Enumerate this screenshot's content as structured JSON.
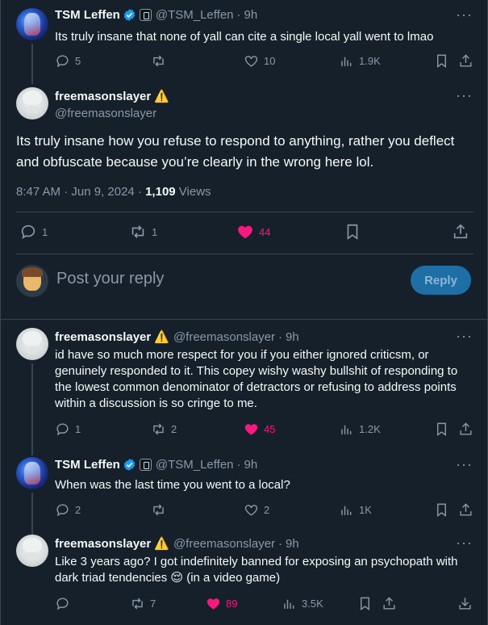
{
  "colors": {
    "background": "#15202b",
    "text": "#f7f9f9",
    "muted": "#8b98a5",
    "like": "#f91880",
    "accent": "#1d9bf0",
    "border": "#38444d"
  },
  "tweets": [
    {
      "name": "TSM Leffen",
      "handle": "@TSM_Leffen",
      "time": "9h",
      "text": "Its truly insane that none of yall can cite a single local yall went to lmao",
      "replies": "5",
      "retweets": "",
      "likes": "10",
      "views": "1.9K",
      "verified": true,
      "liked": false
    },
    {
      "name": "freemasonslayer",
      "handle": "@freemasonslayer",
      "text": "Its truly insane how you refuse to respond to anything, rather you deflect and obfuscate because you’re clearly in the wrong here lol.",
      "timestamp": "8:47 AM · Jun 9, 2024 · ",
      "views_count": "1,109",
      "views_label": " Views",
      "replies": "1",
      "retweets": "1",
      "likes": "44",
      "liked": true
    },
    {
      "name": "freemasonslayer",
      "handle": "@freemasonslayer",
      "time": "9h",
      "text": "id have so much more respect for you if you either ignored criticsm, or genuinely responded to it. This copey wishy washy bullshit of responding to the lowest common denominator of detractors or refusing to address points within a discussion is so cringe to me.",
      "replies": "1",
      "retweets": "2",
      "likes": "45",
      "views": "1.2K",
      "liked": true
    },
    {
      "name": "TSM Leffen",
      "handle": "@TSM_Leffen",
      "time": "9h",
      "text": "When was the last time you went to a local?",
      "replies": "2",
      "retweets": "",
      "likes": "2",
      "views": "1K",
      "verified": true,
      "liked": false
    },
    {
      "name": "freemasonslayer",
      "handle": "@freemasonslayer",
      "time": "9h",
      "text": "Like 3 years ago? I got indefinitely banned for exposing an psychopath with dark triad tendencies 😌 (in a video game)",
      "replies": "",
      "retweets": "7",
      "likes": "89",
      "views": "3.5K",
      "liked": true
    }
  ],
  "reply_box": {
    "placeholder": "Post your reply",
    "button": "Reply"
  },
  "icons": {
    "more": "more-icon",
    "warning": "⚠️",
    "separator": "·"
  }
}
